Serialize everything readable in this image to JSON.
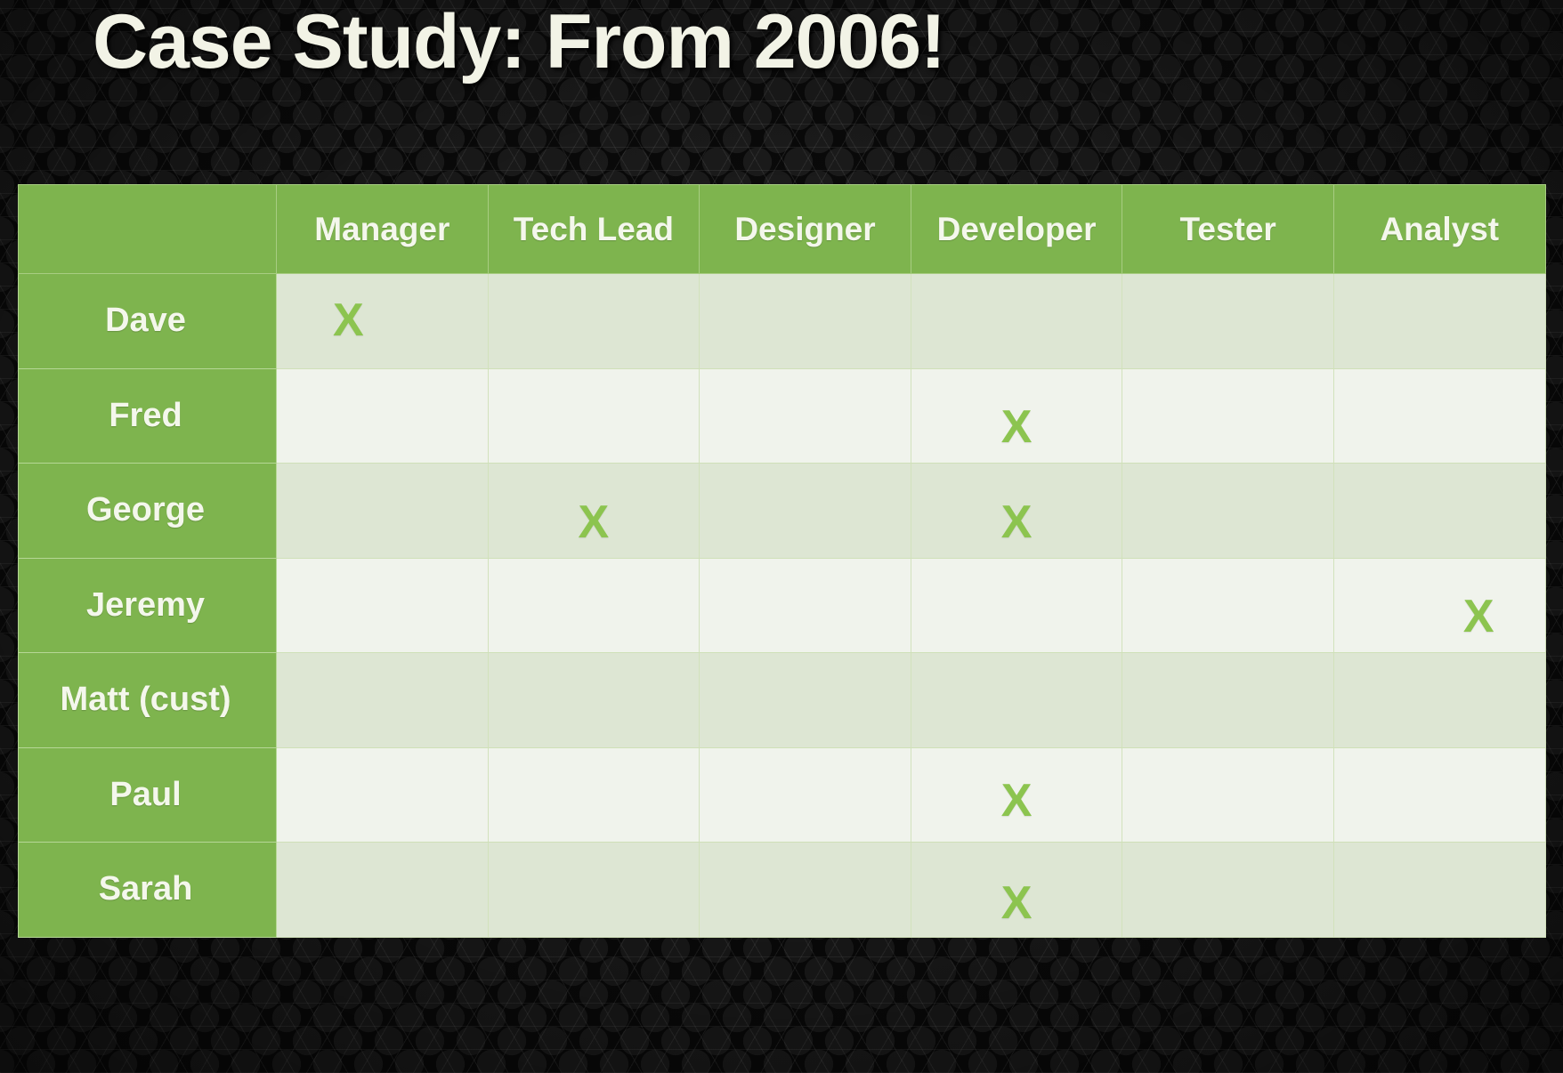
{
  "slide": {
    "title": "Case Study: From 2006!",
    "background_color": "#0a0a0a",
    "title_color": "#f2f3e6",
    "accent_color": "#7eb44e",
    "mark_color": "#8cc44f"
  },
  "matrix": {
    "corner_label": "",
    "columns": [
      "Manager",
      "Tech Lead",
      "Designer",
      "Developer",
      "Tester",
      "Analyst"
    ],
    "rows": [
      {
        "name": "Dave",
        "marks": [
          "X",
          "",
          "",
          "",
          "",
          ""
        ]
      },
      {
        "name": "Fred",
        "marks": [
          "",
          "",
          "",
          "X",
          "",
          ""
        ]
      },
      {
        "name": "George",
        "marks": [
          "",
          "X",
          "",
          "X",
          "",
          ""
        ]
      },
      {
        "name": "Jeremy",
        "marks": [
          "",
          "",
          "",
          "",
          "",
          "X"
        ]
      },
      {
        "name": "Matt (cust)",
        "marks": [
          "",
          "",
          "",
          "",
          "",
          ""
        ]
      },
      {
        "name": "Paul",
        "marks": [
          "",
          "",
          "",
          "X",
          "",
          ""
        ]
      },
      {
        "name": "Sarah",
        "marks": [
          "",
          "",
          "",
          "X",
          "",
          ""
        ]
      }
    ]
  }
}
